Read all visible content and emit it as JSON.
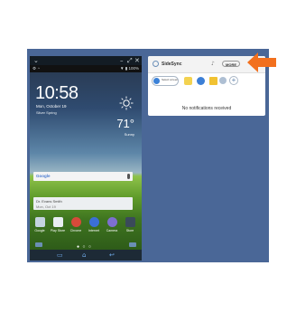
{
  "phone": {
    "status_left": "⚙ ◔",
    "status_right": "▼ ▮ 100%",
    "clock": "10:58",
    "date": "Mon, October 19",
    "location": "Silver Spring",
    "temperature": "71°",
    "weather_sub": "Sunny",
    "search_logo": "Google",
    "widget_line1": "Dr. Evans Smith",
    "widget_line2": "Mon, Oct 19",
    "apps": [
      {
        "label": "Google",
        "color": "#c4d3e0"
      },
      {
        "label": "Play Store",
        "color": "#e9eef3"
      },
      {
        "label": "Chrome",
        "color": "#d64a3a"
      },
      {
        "label": "Internet",
        "color": "#3b6fd6"
      },
      {
        "label": "Camera",
        "color": "#7d6fd0"
      },
      {
        "label": "Store",
        "color": "#3a4a5a"
      }
    ],
    "page_dots": "● ○ ○"
  },
  "sidesync": {
    "title": "SideSync",
    "more_label": "MORE",
    "select_screen_label": "Select screen",
    "no_notifications": "No notifications received",
    "tool_colors": [
      "#f3d250",
      "#3c7fd6",
      "#f1c232"
    ]
  },
  "accent": {
    "arrow": "#f2701e",
    "desktop_bg": "#4a6797"
  }
}
